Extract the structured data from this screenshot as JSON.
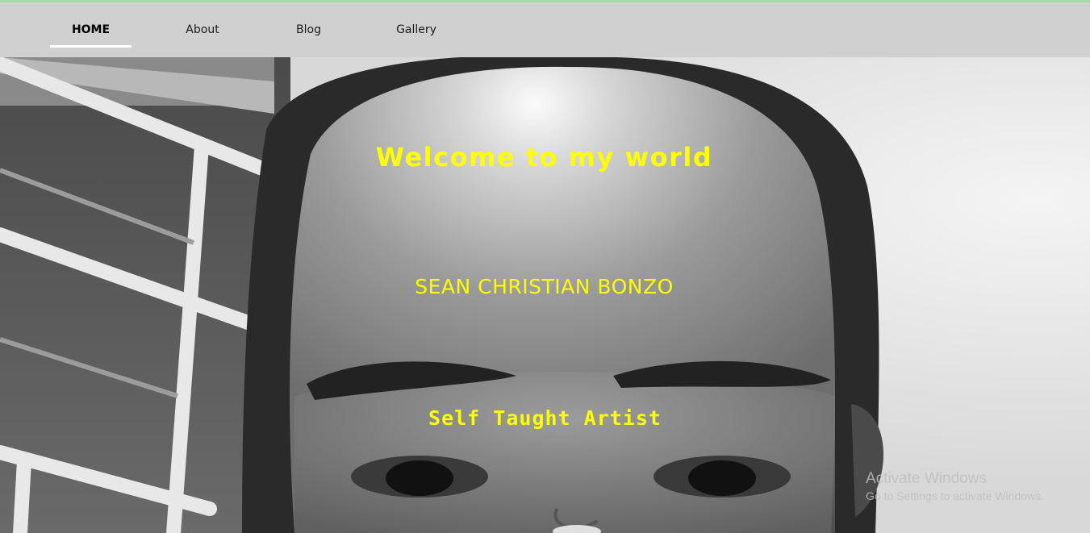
{
  "nav": {
    "items": [
      {
        "label": "HOME",
        "active": true
      },
      {
        "label": "About",
        "active": false
      },
      {
        "label": "Blog",
        "active": false
      },
      {
        "label": "Gallery",
        "active": false
      }
    ]
  },
  "hero": {
    "welcome": "Welcome to my world",
    "name": "SEAN CHRISTIAN BONZO",
    "tagline": "Self Taught Artist",
    "text_color": "#ffff00",
    "image_style": "grayscale-portrait-photo"
  },
  "overlay": {
    "activate_title": "Activate Windows",
    "activate_subtitle": "Go to Settings to activate Windows."
  },
  "colors": {
    "navbar": "#d0d0d0",
    "accent_line": "#a8d8a8"
  }
}
